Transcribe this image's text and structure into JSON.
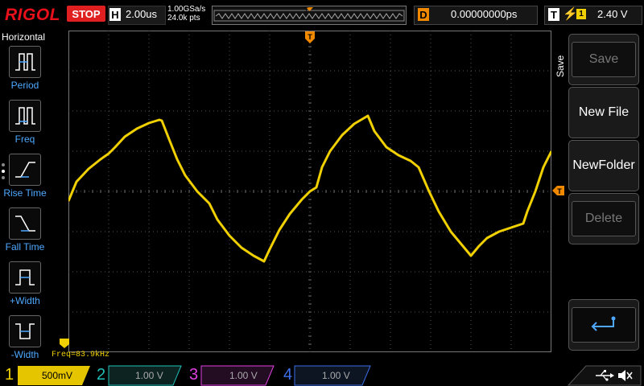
{
  "brand": "RIGOL",
  "run_state": "STOP",
  "horizontal": {
    "letter": "H",
    "timebase": "2.00us",
    "sample_rate": "1.00GSa/s",
    "points": "24.0k pts"
  },
  "memory_marker": "T",
  "delay": {
    "letter": "D",
    "value": "0.00000000ps"
  },
  "trigger": {
    "letter": "T",
    "edge_symbol": "⚡",
    "source": "1",
    "level": "2.40 V"
  },
  "left_menu": {
    "title": "Horizontal",
    "items": [
      "Period",
      "Freq",
      "Rise Time",
      "Fall Time",
      "+Width",
      "-Width"
    ]
  },
  "right_menu": {
    "title": "Save",
    "items": [
      {
        "label": "Save",
        "disabled": true
      },
      {
        "label": "New File",
        "disabled": false
      },
      {
        "label": "NewFolder",
        "disabled": false
      },
      {
        "label": "Delete",
        "disabled": true
      }
    ]
  },
  "measurement": "Freq=83.9kHz",
  "trigger_marker": "T",
  "channels": [
    {
      "num": "1",
      "value": "500mV",
      "color": "#f0d000",
      "active": true
    },
    {
      "num": "2",
      "value": "1.00 V",
      "color": "#1fbfb8",
      "active": false
    },
    {
      "num": "3",
      "value": "1.00 V",
      "color": "#e040e0",
      "active": false
    },
    {
      "num": "4",
      "value": "1.00 V",
      "color": "#3a6ee8",
      "active": false
    }
  ],
  "colors": {
    "accent": "#4ea8ff",
    "trace": "#f0d000",
    "brand": "#e8101a",
    "stop": "#e02020",
    "delay": "#f08800"
  }
}
